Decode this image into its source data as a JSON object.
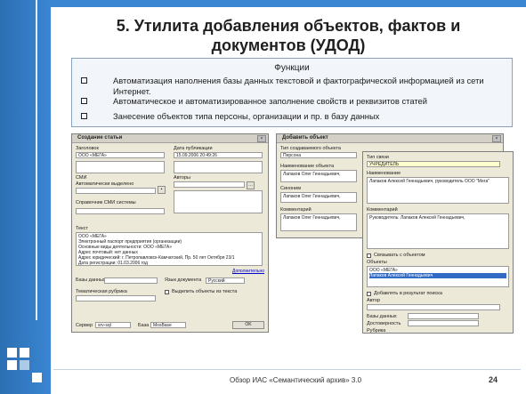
{
  "slide": {
    "title_line1": "5. Утилита добавления объектов, фактов и",
    "title_line2": "документов  (УДОД)",
    "functions_header": "Функции",
    "functions": [
      "Автоматизация наполнения базы данных текстовой и фактографической информацией из сети Интернет.",
      "Автоматическое и автоматизированное заполнение свойств и реквизитов статей",
      "Занесение объектов типа персоны, организации и пр. в базу данных"
    ],
    "footer": "Обзор ИАС «Семантический архив» 3.0",
    "page": "24"
  },
  "article_dialog": {
    "title": "Создание статьи",
    "zagolovok_label": "Заголовок",
    "zagolovok_value": "ООО «МЕГА»",
    "date_label": "Дата публикации",
    "date_value": "15.09.2006 20:49:26",
    "smi_label": "СМИ",
    "auto_label": "Автоматически выделено",
    "authors_label": "Авторы",
    "sprav_label": "Справочник СМИ системы",
    "text_label": "Текст",
    "text_lines": [
      "ООО «МЕГА»",
      "Электронный паспорт предприятия (организации)",
      "Основные виды деятельности: ООО «МЕГА»",
      "Адрес почтовый: нет данных",
      "Адрес юридический: г. Петропавловск-Камчатский, Пр. 50 лет Октября 23/1",
      "Дата регистрации: 01.03.2006 год"
    ],
    "more_link": "Дополнительно",
    "db_label": "Базы данных",
    "lang_label": "Язык документа",
    "lang_value": "Русский",
    "theme_label": "Тематическая рубрика",
    "highlight_label": "Выделить объекты из текста",
    "server_label": "Сервер",
    "server_value": "srv-sql",
    "base_label": "База",
    "base_value": "MosBase"
  },
  "object_dialog": {
    "title": "Добавить объект",
    "type_label": "Тип создаваемого объекта",
    "type_value": "Персона",
    "name_label": "Наименование объекта",
    "name_value": "Лапаков Олег Геннадьевич,",
    "syn_label": "Синоним",
    "syn_value": "Лапаков Олег Геннадьевич,",
    "comment_label": "Комментарий",
    "comment_value": "Лапаков Олег Геннадьевич,"
  },
  "org_dialog": {
    "type_label": "Тип связи",
    "type_value": "УЧРЕДИТЕЛЬ",
    "name_label": "Наименование",
    "name_value": "Лапаков Алексей Геннадьевич, руководитель ООО \"Мега\"",
    "comment_label": "Комментарий",
    "comment_value": "Руководитель: Лапаков Алексей Геннадьевич,",
    "link_label": "Связывать с объектом",
    "objects_label": "Объекты",
    "objects": [
      "ООО «МЕГА»",
      "Лапаков Алексей Геннадьевич"
    ],
    "add_label": "Добавлять в результат поиска",
    "author_label": "Автор",
    "db_label": "Базы данных",
    "reliab_label": "Достоверность",
    "rubric_label": "Рубрика"
  }
}
